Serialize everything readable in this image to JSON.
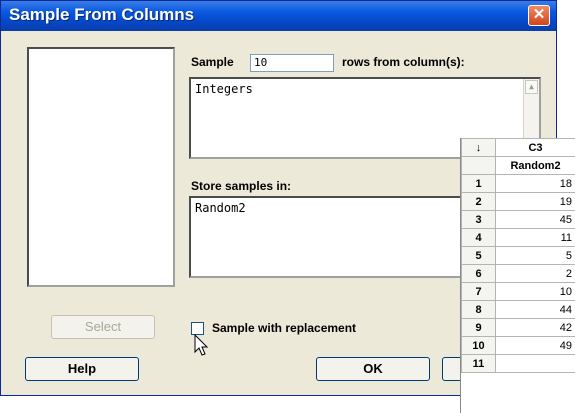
{
  "dialog": {
    "title": "Sample From Columns",
    "close_glyph": "✕",
    "sample_label": "Sample",
    "sample_value": "10",
    "rows_label": "rows from column(s):",
    "columns_text": "Integers",
    "store_label": "Store samples in:",
    "store_text": "Random2",
    "replacement_label": "Sample with replacement",
    "replacement_checked": false,
    "buttons": {
      "select": "Select",
      "help": "Help",
      "ok": "OK"
    }
  },
  "worksheet": {
    "arrow": "↓",
    "column_id": "C3",
    "column_name": "Random2",
    "rows": [
      {
        "n": "1",
        "v": "18"
      },
      {
        "n": "2",
        "v": "19"
      },
      {
        "n": "3",
        "v": "45"
      },
      {
        "n": "4",
        "v": "11"
      },
      {
        "n": "5",
        "v": "5"
      },
      {
        "n": "6",
        "v": "2"
      },
      {
        "n": "7",
        "v": "10"
      },
      {
        "n": "8",
        "v": "44"
      },
      {
        "n": "9",
        "v": "42"
      },
      {
        "n": "10",
        "v": "49"
      },
      {
        "n": "11",
        "v": ""
      }
    ]
  },
  "icons": {
    "close": "close-icon",
    "scroll_up": "scroll-up-arrow-icon",
    "cursor": "mouse-pointer-icon"
  }
}
